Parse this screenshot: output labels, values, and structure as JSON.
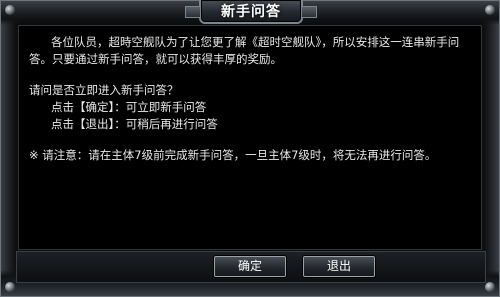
{
  "dialog": {
    "title": "新手问答",
    "paragraph1": "各位队员，超時空舰队为了让您更了解《超时空舰队》，所以安排这一连串新手问答。只要通过新手问答，就可以获得丰厚的奖励。",
    "question": "请问是否立即进入新手问答？",
    "option_confirm": "点击【确定】：可立即新手问答",
    "option_exit": "点击【退出】：可稍后再进行问答",
    "notice": "※ 请注意：请在主体7级前完成新手问答，一旦主体7级时，将无法再进行问答。"
  },
  "buttons": {
    "confirm": "确定",
    "exit": "退出"
  }
}
